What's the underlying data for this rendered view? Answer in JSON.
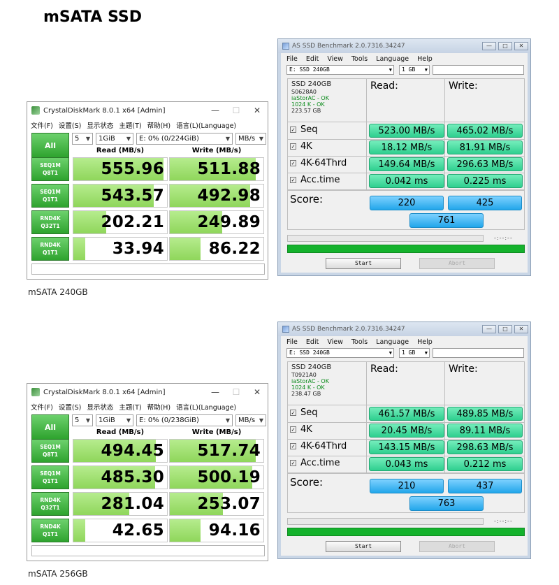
{
  "page": {
    "title": "mSATA SSD"
  },
  "captions": [
    "mSATA 240GB",
    "mSATA 256GB"
  ],
  "cdm_common": {
    "title": "CrystalDiskMark 8.0.1 x64 [Admin]",
    "menu": [
      "文件(F)",
      "设置(S)",
      "显示状态",
      "主题(T)",
      "帮助(H)",
      "语言(L)(Language)"
    ],
    "all_label": "All",
    "count": "5",
    "size": "1GiB",
    "unit": "MB/s",
    "read_header": "Read (MB/s)",
    "write_header": "Write (MB/s)",
    "tests": [
      {
        "l1": "SEQ1M",
        "l2": "Q8T1"
      },
      {
        "l1": "SEQ1M",
        "l2": "Q1T1"
      },
      {
        "l1": "RND4K",
        "l2": "Q32T1"
      },
      {
        "l1": "RND4K",
        "l2": "Q1T1"
      }
    ],
    "window_buttons": {
      "min": "—",
      "max": "☐",
      "close": "✕"
    }
  },
  "cdm": [
    {
      "drive": "E: 0% (0/224GiB)",
      "read": [
        "555.96",
        "543.57",
        "202.21",
        "33.94"
      ],
      "write": [
        "511.88",
        "492.98",
        "249.89",
        "86.22"
      ],
      "read_fill": [
        0.96,
        0.86,
        0.35,
        0.13
      ],
      "write_fill": [
        0.92,
        0.86,
        0.56,
        0.33
      ]
    },
    {
      "drive": "E: 0% (0/238GiB)",
      "read": [
        "494.45",
        "485.30",
        "281.04",
        "42.65"
      ],
      "write": [
        "517.74",
        "500.19",
        "253.07",
        "94.16"
      ],
      "read_fill": [
        0.88,
        0.87,
        0.6,
        0.13
      ],
      "write_fill": [
        0.92,
        0.88,
        0.57,
        0.33
      ]
    }
  ],
  "as_common": {
    "title": "AS SSD Benchmark 2.0.7316.34247",
    "menu": [
      "File",
      "Edit",
      "View",
      "Tools",
      "Language",
      "Help"
    ],
    "drive": "E: SSD  240GB",
    "size": "1 GB",
    "read_header": "Read:",
    "write_header": "Write:",
    "tests": [
      "Seq",
      "4K",
      "4K-64Thrd",
      "Acc.time"
    ],
    "score_label": "Score:",
    "time": "-:--:--",
    "start": "Start",
    "abort": "Abort",
    "check": "☑",
    "window_buttons": {
      "min": "—",
      "max": "□",
      "close": "✕"
    }
  },
  "as": [
    {
      "model": "SSD  240GB",
      "fw": "S0628A0",
      "driver": "iaStorAC - OK",
      "align": "1024 K - OK",
      "capacity": "223.57 GB",
      "read": [
        "523.00 MB/s",
        "18.12 MB/s",
        "149.64 MB/s",
        "0.042 ms"
      ],
      "write": [
        "465.02 MB/s",
        "81.91 MB/s",
        "296.63 MB/s",
        "0.225 ms"
      ],
      "score_read": "220",
      "score_write": "425",
      "score_total": "761"
    },
    {
      "model": "SSD  240GB",
      "fw": "T0921A0",
      "driver": "iaStorAC - OK",
      "align": "1024 K - OK",
      "capacity": "238.47 GB",
      "read": [
        "461.57 MB/s",
        "20.45 MB/s",
        "143.15 MB/s",
        "0.043 ms"
      ],
      "write": [
        "489.85 MB/s",
        "89.11 MB/s",
        "298.63 MB/s",
        "0.212 ms"
      ],
      "score_read": "210",
      "score_write": "437",
      "score_total": "763"
    }
  ]
}
